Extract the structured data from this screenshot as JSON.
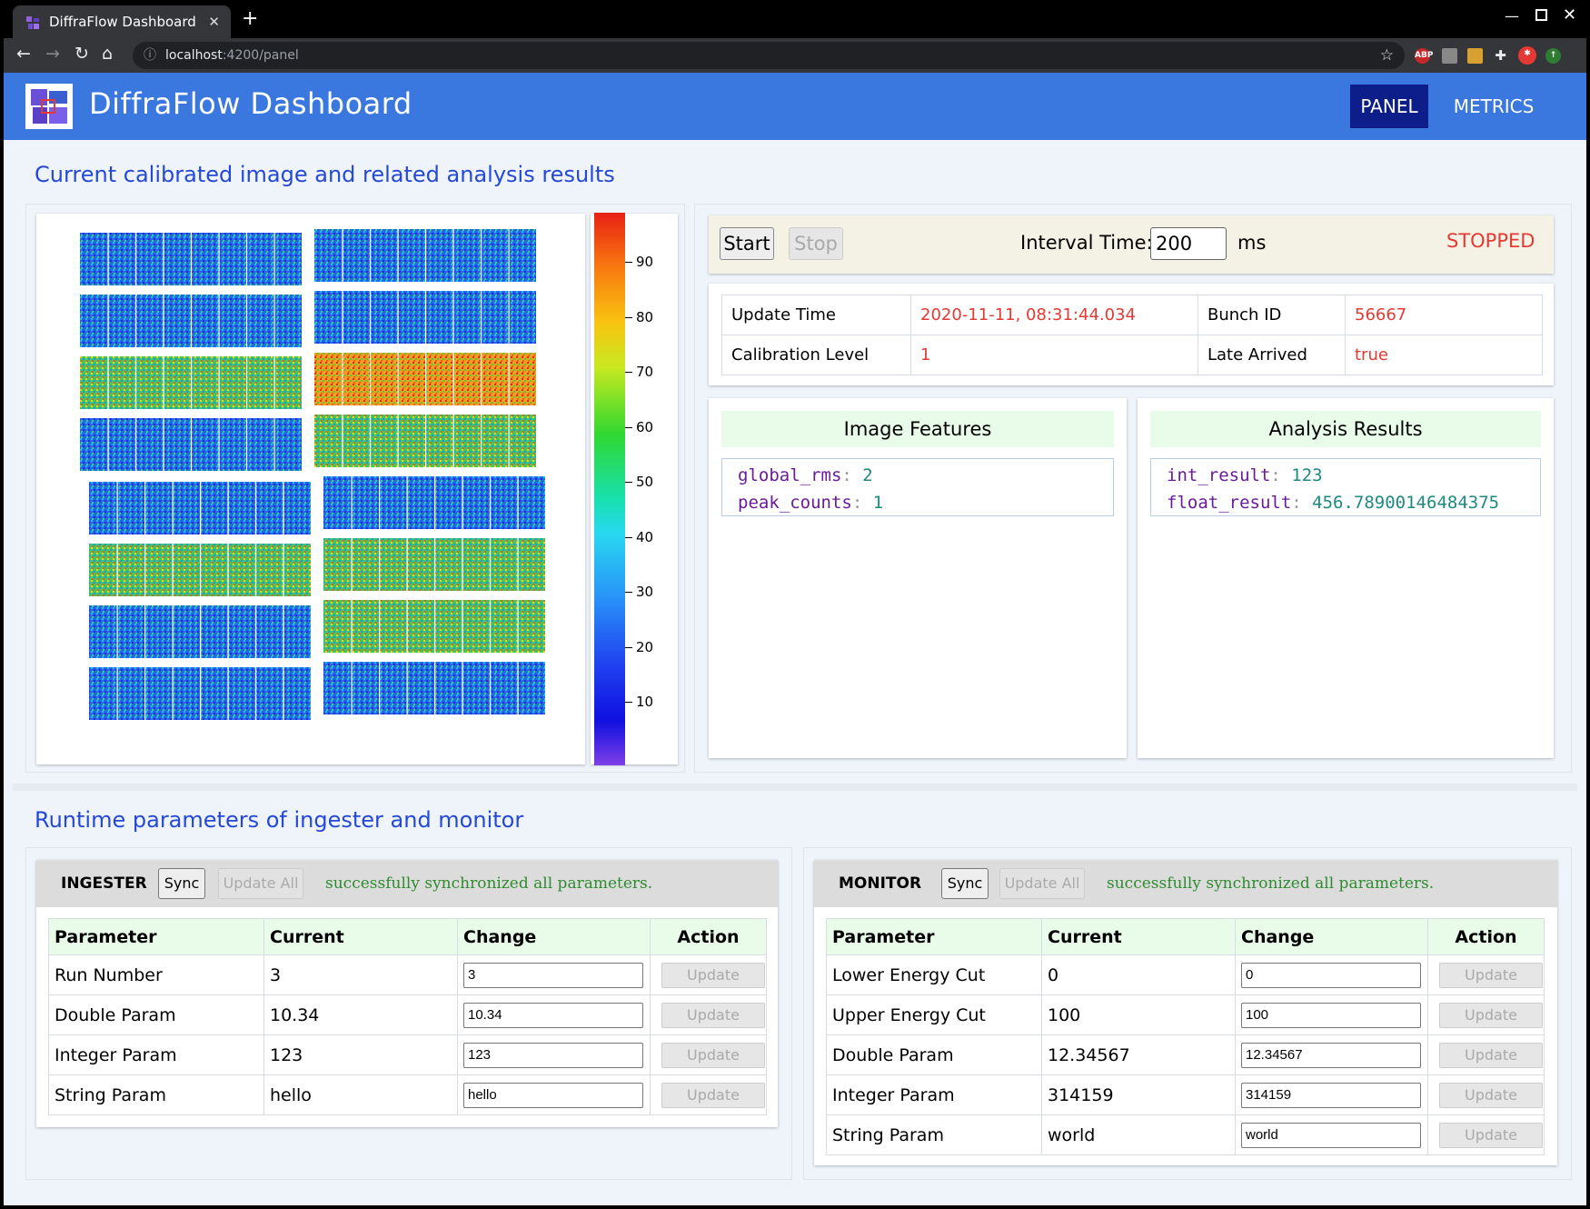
{
  "browser": {
    "tab_title": "DiffraFlow Dashboard",
    "url_host": "localhost",
    "url_path": ":4200/panel",
    "ext_abp": "ABP"
  },
  "app": {
    "title": "DiffraFlow Dashboard",
    "nav": {
      "panel": "PANEL",
      "metrics": "METRICS"
    },
    "accent_color": "#3a78df"
  },
  "section1": {
    "title": "Current calibrated image and related analysis results"
  },
  "colorbar": {
    "ticks": [
      "90",
      "80",
      "70",
      "60",
      "50",
      "40",
      "30",
      "20",
      "10"
    ]
  },
  "control": {
    "start_label": "Start",
    "stop_label": "Stop",
    "interval_label": "Interval Time:",
    "interval_value": "200",
    "interval_unit": "ms",
    "status": "STOPPED"
  },
  "info": {
    "update_time_label": "Update Time",
    "update_time_value": "2020-11-11, 08:31:44.034",
    "bunch_id_label": "Bunch ID",
    "bunch_id_value": "56667",
    "calib_label": "Calibration Level",
    "calib_value": "1",
    "late_label": "Late Arrived",
    "late_value": "true"
  },
  "features": {
    "title": "Image Features",
    "k1": "global_rms",
    "v1": "2",
    "k2": "peak_counts",
    "v2": "1"
  },
  "analysis": {
    "title": "Analysis Results",
    "k1": "int_result",
    "v1": "123",
    "k2": "float_result",
    "v2": "456.78900146484375"
  },
  "section2": {
    "title": "Runtime parameters of ingester and monitor"
  },
  "ingester": {
    "name": "INGESTER",
    "sync_label": "Sync",
    "update_all_label": "Update All",
    "message": "successfully synchronized all parameters.",
    "headers": [
      "Parameter",
      "Current",
      "Change",
      "Action"
    ],
    "update_label": "Update",
    "rows": [
      {
        "param": "Run Number",
        "current": "3",
        "change": "3"
      },
      {
        "param": "Double Param",
        "current": "10.34",
        "change": "10.34"
      },
      {
        "param": "Integer Param",
        "current": "123",
        "change": "123"
      },
      {
        "param": "String Param",
        "current": "hello",
        "change": "hello"
      }
    ]
  },
  "monitor": {
    "name": "MONITOR",
    "sync_label": "Sync",
    "update_all_label": "Update All",
    "message": "successfully synchronized all parameters.",
    "headers": [
      "Parameter",
      "Current",
      "Change",
      "Action"
    ],
    "update_label": "Update",
    "rows": [
      {
        "param": "Lower Energy Cut",
        "current": "0",
        "change": "0"
      },
      {
        "param": "Upper Energy Cut",
        "current": "100",
        "change": "100"
      },
      {
        "param": "Double Param",
        "current": "12.34567",
        "change": "12.34567"
      },
      {
        "param": "Integer Param",
        "current": "314159",
        "change": "314159"
      },
      {
        "param": "String Param",
        "current": "world",
        "change": "world"
      }
    ]
  }
}
